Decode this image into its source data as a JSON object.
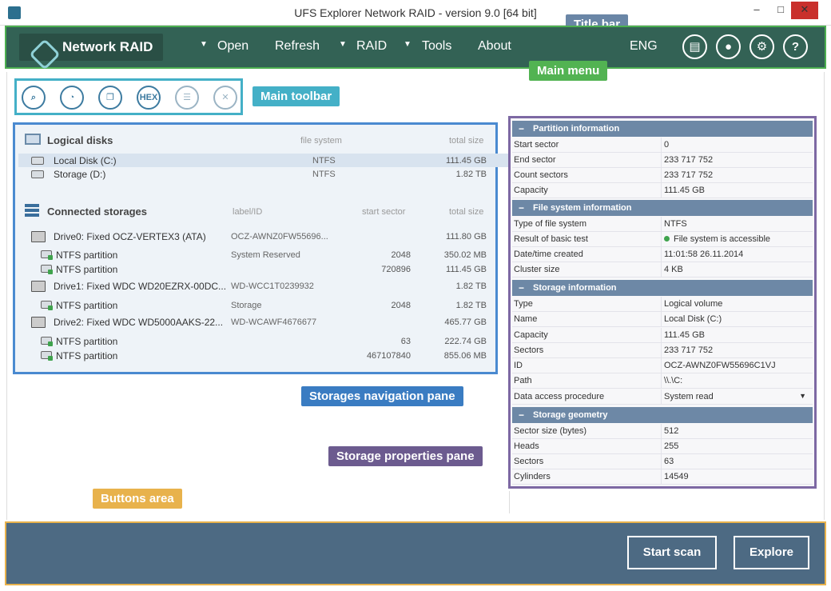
{
  "window": {
    "title": "UFS Explorer Network RAID - version 9.0 [64 bit]",
    "min": "–",
    "max": "□",
    "close": "✕"
  },
  "menu": {
    "logo": "Network RAID",
    "items": [
      {
        "label": "Open",
        "arrow": "▼"
      },
      {
        "label": "Refresh",
        "arrow": ""
      },
      {
        "label": "RAID",
        "arrow": "▼"
      },
      {
        "label": "Tools",
        "arrow": "▼"
      },
      {
        "label": "About",
        "arrow": ""
      }
    ],
    "language": "ENG",
    "help_glyph": "?",
    "user_glyph": "●",
    "settings_glyph": "⚙",
    "notes_glyph": "▤"
  },
  "callouts": {
    "title_bar": "Title bar",
    "main_menu": "Main menu",
    "main_toolbar": "Main toolbar",
    "storages_nav": "Storages navigation pane",
    "storage_props": "Storage properties pane",
    "buttons_area": "Buttons area"
  },
  "toolbar": {
    "search_glyph": "⌕",
    "pie_glyph": "◔",
    "image_glyph": "❐",
    "hex_label": "HEX",
    "list_glyph": "☰",
    "close_glyph": "✕"
  },
  "nav": {
    "logical": {
      "title": "Logical disks",
      "col_fs": "file system",
      "col_size": "total size",
      "rows": [
        {
          "name": "Local Disk (C:)",
          "fs": "NTFS",
          "size": "111.45 GB"
        },
        {
          "name": "Storage (D:)",
          "fs": "NTFS",
          "size": "1.82 TB"
        }
      ]
    },
    "connected": {
      "title": "Connected storages",
      "col_label": "label/ID",
      "col_start": "start sector",
      "col_size": "total size",
      "rows": [
        {
          "kind": "drive",
          "name": "Drive0: Fixed OCZ-VERTEX3 (ATA)",
          "label": "OCZ-AWNZ0FW55696...",
          "start": "",
          "size": "111.80 GB"
        },
        {
          "kind": "part",
          "name": "NTFS partition",
          "label": "System Reserved",
          "start": "2048",
          "size": "350.02 MB"
        },
        {
          "kind": "part",
          "name": "NTFS partition",
          "label": "",
          "start": "720896",
          "size": "111.45 GB"
        },
        {
          "kind": "drive",
          "name": "Drive1: Fixed WDC WD20EZRX-00DC...",
          "label": "WD-WCC1T0239932",
          "start": "",
          "size": "1.82 TB"
        },
        {
          "kind": "part",
          "name": "NTFS partition",
          "label": "Storage",
          "start": "2048",
          "size": "1.82 TB"
        },
        {
          "kind": "drive",
          "name": "Drive2: Fixed WDC WD5000AAKS-22...",
          "label": "WD-WCAWF4676677",
          "start": "",
          "size": "465.77 GB"
        },
        {
          "kind": "part",
          "name": "NTFS partition",
          "label": "",
          "start": "63",
          "size": "222.74 GB"
        },
        {
          "kind": "part",
          "name": "NTFS partition",
          "label": "",
          "start": "467107840",
          "size": "855.06 MB"
        }
      ]
    }
  },
  "props": {
    "sections": [
      {
        "title": "Partition information",
        "rows": [
          {
            "k": "Start sector",
            "v": "0"
          },
          {
            "k": "End sector",
            "v": "233 717 752"
          },
          {
            "k": "Count sectors",
            "v": "233 717 752"
          },
          {
            "k": "Capacity",
            "v": "111.45 GB"
          }
        ]
      },
      {
        "title": "File system information",
        "rows": [
          {
            "k": "Type of file system",
            "v": "NTFS"
          },
          {
            "k": "Result of basic test",
            "v": "File system is accessible",
            "status": "ok"
          },
          {
            "k": "Date/time created",
            "v": "11:01:58 26.11.2014"
          },
          {
            "k": "Cluster size",
            "v": "4 KB"
          }
        ]
      },
      {
        "title": "Storage information",
        "rows": [
          {
            "k": "Type",
            "v": "Logical volume"
          },
          {
            "k": "Name",
            "v": "Local Disk (C:)"
          },
          {
            "k": "Capacity",
            "v": "111.45 GB"
          },
          {
            "k": "Sectors",
            "v": "233 717 752"
          },
          {
            "k": "ID",
            "v": "OCZ-AWNZ0FW55696C1VJ"
          },
          {
            "k": "Path",
            "v": "\\\\.\\C:"
          },
          {
            "k": "Data access procedure",
            "v": "System read",
            "dropdown": "▼"
          }
        ]
      },
      {
        "title": "Storage geometry",
        "rows": [
          {
            "k": "Sector size (bytes)",
            "v": "512"
          },
          {
            "k": "Heads",
            "v": "255"
          },
          {
            "k": "Sectors",
            "v": "63"
          },
          {
            "k": "Cylinders",
            "v": "14549"
          }
        ]
      }
    ]
  },
  "actions": {
    "start_scan": "Start scan",
    "explore": "Explore"
  }
}
